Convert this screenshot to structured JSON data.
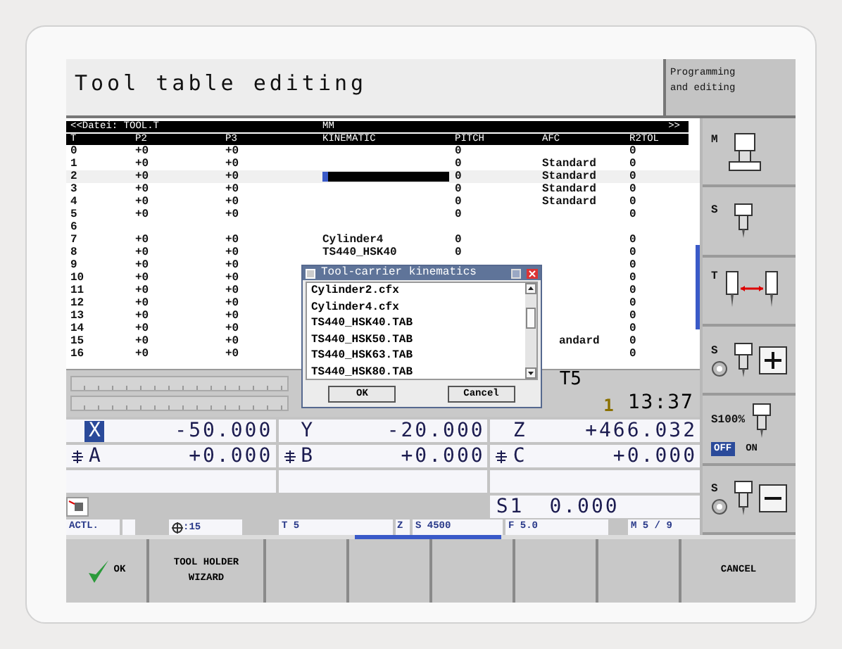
{
  "header": {
    "title": "Tool table editing",
    "mode": "Programming and editing"
  },
  "table": {
    "file": "<<Datei: TOOL.T",
    "unit": "MM",
    "more": ">>",
    "columns": [
      "T",
      "P2",
      "P3",
      "KINEMATIC",
      "PITCH",
      "AFC",
      "R2TOL"
    ],
    "rows": [
      {
        "t": "0",
        "p2": "+0",
        "p3": "+0",
        "pitch": "0",
        "r2tol": "0",
        "editing": false
      },
      {
        "t": "1",
        "p2": "+0",
        "p3": "+0",
        "pitch": "0",
        "afc": "Standard",
        "r2tol": "0",
        "editing": false
      },
      {
        "t": "2",
        "p2": "+0",
        "p3": "+0",
        "pitch": "0",
        "afc": "Standard",
        "r2tol": "0",
        "editing": true
      },
      {
        "t": "3",
        "p2": "+0",
        "p3": "+0",
        "pitch": "0",
        "afc": "Standard",
        "r2tol": "0",
        "editing": false
      },
      {
        "t": "4",
        "p2": "+0",
        "p3": "+0",
        "pitch": "0",
        "afc": "Standard",
        "r2tol": "0",
        "editing": false
      },
      {
        "t": "5",
        "p2": "+0",
        "p3": "+0",
        "pitch": "0",
        "r2tol": "0",
        "editing": false
      },
      {
        "t": "6",
        "editing": false
      },
      {
        "t": "7",
        "p2": "+0",
        "p3": "+0",
        "kinematic": "Cylinder4",
        "pitch": "0",
        "r2tol": "0",
        "editing": false
      },
      {
        "t": "8",
        "p2": "+0",
        "p3": "+0",
        "kinematic": "TS440_HSK40",
        "pitch": "0",
        "r2tol": "0",
        "editing": false
      },
      {
        "t": "9",
        "p2": "+0",
        "p3": "+0",
        "r2tol": "0",
        "editing": false
      },
      {
        "t": "10",
        "p2": "+0",
        "p3": "+0",
        "r2tol": "0",
        "editing": false
      },
      {
        "t": "11",
        "p2": "+0",
        "p3": "+0",
        "r2tol": "0",
        "editing": false
      },
      {
        "t": "12",
        "p2": "+0",
        "p3": "+0",
        "r2tol": "0",
        "editing": false
      },
      {
        "t": "13",
        "p2": "+0",
        "p3": "+0",
        "r2tol": "0",
        "editing": false
      },
      {
        "t": "14",
        "p2": "+0",
        "p3": "+0",
        "r2tol": "0",
        "editing": false
      },
      {
        "t": "15",
        "p2": "+0",
        "p3": "+0",
        "afc": "andard",
        "r2tol": "0",
        "editing": false
      },
      {
        "t": "16",
        "p2": "+0",
        "p3": "+0",
        "r2tol": "0",
        "editing": false
      }
    ]
  },
  "dialog": {
    "title": "Tool-carrier kinematics",
    "items": [
      "Cylinder2.cfx",
      "Cylinder4.cfx",
      "TS440_HSK40.TAB",
      "TS440_HSK50.TAB",
      "TS440_HSK63.TAB",
      "TS440_HSK80.TAB"
    ],
    "buttons": [
      "OK",
      "Cancel"
    ]
  },
  "status": {
    "tool": "T5",
    "counter": "1",
    "time": "13:37"
  },
  "positions": [
    {
      "axis": "X",
      "value": "-50.000",
      "selected": true,
      "kind": "linear"
    },
    {
      "axis": "Y",
      "value": "-20.000",
      "selected": false,
      "kind": "linear"
    },
    {
      "axis": "Z",
      "value": "+466.032",
      "selected": false,
      "kind": "linear"
    },
    {
      "axis": "A",
      "value": "+0.000",
      "selected": false,
      "kind": "rotary"
    },
    {
      "axis": "B",
      "value": "+0.000",
      "selected": false,
      "kind": "rotary"
    },
    {
      "axis": "C",
      "value": "+0.000",
      "selected": false,
      "kind": "rotary"
    }
  ],
  "spindle": {
    "label": "S1",
    "value": "0.000"
  },
  "status_bar": {
    "mode": "ACTL.",
    "rotation": ":15",
    "tool": "T 5",
    "axis": "Z",
    "speed": "S 4500",
    "feed": "F 5.0",
    "mfunc": "M 5 / 9"
  },
  "sidebar": [
    {
      "label": "M",
      "kind": "holder"
    },
    {
      "label": "S",
      "kind": "tool"
    },
    {
      "label": "T",
      "kind": "change"
    },
    {
      "label": "S",
      "kind": "plus"
    },
    {
      "label": "S100%",
      "kind": "override",
      "off": "OFF",
      "on": "ON"
    },
    {
      "label": "S",
      "kind": "minus"
    }
  ],
  "softkeys": [
    {
      "kind": "confirm",
      "label": "OK"
    },
    {
      "kind": "text",
      "label": "TOOL HOLDER WIZARD"
    },
    {
      "kind": "blank"
    },
    {
      "kind": "blank"
    },
    {
      "kind": "blank"
    },
    {
      "kind": "blank"
    },
    {
      "kind": "blank"
    },
    {
      "kind": "text",
      "label": "CANCEL"
    }
  ]
}
